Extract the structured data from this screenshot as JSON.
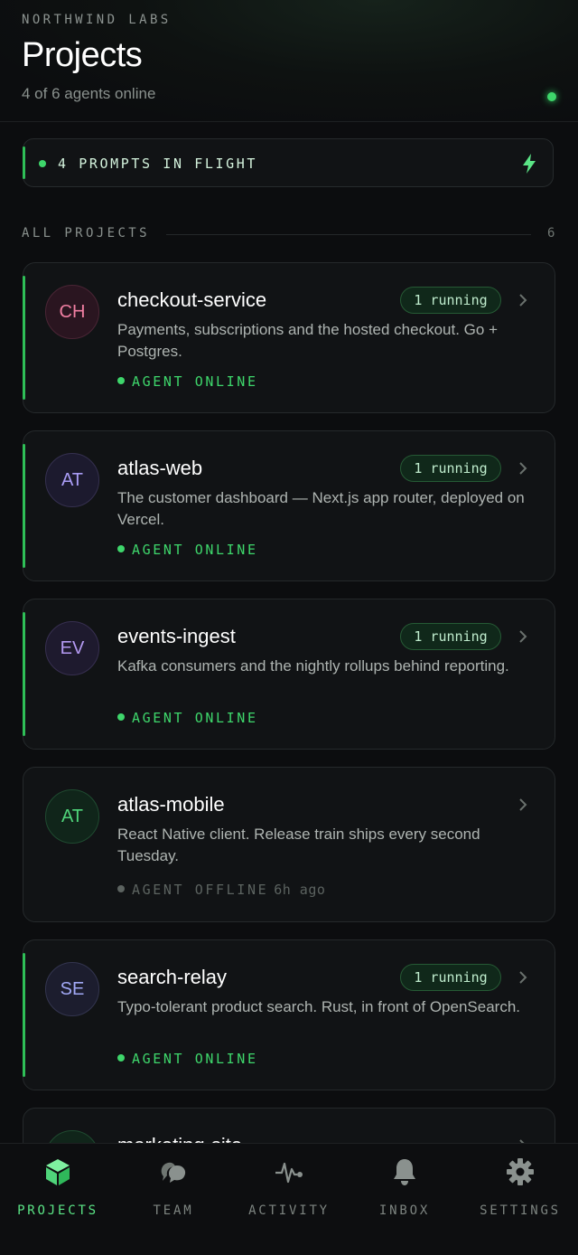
{
  "header": {
    "org": "NORTHWIND LABS",
    "title": "Projects",
    "subtitle": "4 of 6 agents online"
  },
  "banner": {
    "text": "4 PROMPTS IN FLIGHT",
    "icon": "bolt-icon"
  },
  "section": {
    "label": "ALL PROJECTS",
    "count": "6"
  },
  "projects": [
    {
      "initials": "CH",
      "name": "checkout-service",
      "description": "Payments, subscriptions and the hosted checkout. Go + Postgres.",
      "status": "AGENT ONLINE",
      "badge": "1 running",
      "avatar_color": "#f07fa2"
    },
    {
      "initials": "AT",
      "name": "atlas-web",
      "description": "The customer dashboard — Next.js app router, deployed on Vercel.",
      "status": "AGENT ONLINE",
      "badge": "1 running",
      "avatar_color": "#a99cf5"
    },
    {
      "initials": "EV",
      "name": "events-ingest",
      "description": "Kafka consumers and the nightly rollups behind reporting.",
      "status": "AGENT ONLINE",
      "badge": "1 running",
      "avatar_color": "#b49af2"
    },
    {
      "initials": "AT",
      "name": "atlas-mobile",
      "description": "React Native client. Release train ships every second Tuesday.",
      "status": "AGENT OFFLINE",
      "status_ago": "6h ago",
      "avatar_color": "#4fd47a"
    },
    {
      "initials": "SE",
      "name": "search-relay",
      "description": "Typo-tolerant product search. Rust, in front of OpenSearch.",
      "status": "AGENT ONLINE",
      "badge": "1 running",
      "avatar_color": "#a1a8f5"
    },
    {
      "name": "marketing-site"
    }
  ],
  "nav": [
    {
      "label": "PROJECTS",
      "icon": "cube-icon",
      "active": true
    },
    {
      "label": "TEAM",
      "icon": "chat-bubbles-icon",
      "active": false
    },
    {
      "label": "ACTIVITY",
      "icon": "pulse-icon",
      "active": false
    },
    {
      "label": "INBOX",
      "icon": "bell-icon",
      "active": false
    },
    {
      "label": "SETTINGS",
      "icon": "gear-icon",
      "active": false
    }
  ],
  "colors": {
    "accent": "#3ed66b",
    "background": "#0c0d0f",
    "card": "#111315"
  }
}
